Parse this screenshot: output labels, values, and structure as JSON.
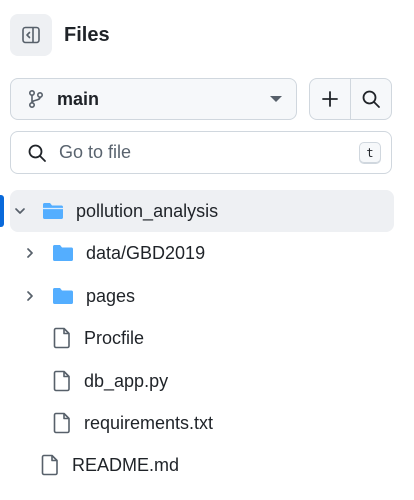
{
  "header": {
    "title": "Files"
  },
  "branch": {
    "name": "main"
  },
  "search": {
    "placeholder": "Go to file",
    "shortcut": "t"
  },
  "tree": [
    {
      "label": "pollution_analysis",
      "type": "folder-open",
      "expanded": true,
      "selected": true
    },
    {
      "label": "data/GBD2019",
      "type": "folder",
      "expanded": false
    },
    {
      "label": "pages",
      "type": "folder",
      "expanded": false
    },
    {
      "label": "Procfile",
      "type": "file"
    },
    {
      "label": "db_app.py",
      "type": "file"
    },
    {
      "label": "requirements.txt",
      "type": "file"
    },
    {
      "label": "README.md",
      "type": "file"
    }
  ],
  "colors": {
    "folder": "#54aeff",
    "accent": "#0969da",
    "icon": "#57606a"
  }
}
